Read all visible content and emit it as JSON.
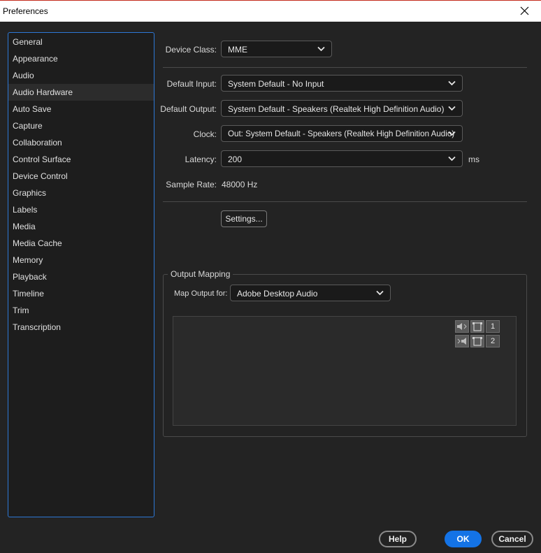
{
  "window": {
    "title": "Preferences"
  },
  "sidebar": {
    "items": [
      {
        "label": "General"
      },
      {
        "label": "Appearance"
      },
      {
        "label": "Audio"
      },
      {
        "label": "Audio Hardware"
      },
      {
        "label": "Auto Save"
      },
      {
        "label": "Capture"
      },
      {
        "label": "Collaboration"
      },
      {
        "label": "Control Surface"
      },
      {
        "label": "Device Control"
      },
      {
        "label": "Graphics"
      },
      {
        "label": "Labels"
      },
      {
        "label": "Media"
      },
      {
        "label": "Media Cache"
      },
      {
        "label": "Memory"
      },
      {
        "label": "Playback"
      },
      {
        "label": "Timeline"
      },
      {
        "label": "Trim"
      },
      {
        "label": "Transcription"
      }
    ],
    "selected": "Audio Hardware"
  },
  "audio_hardware": {
    "device_class_label": "Device Class:",
    "device_class_value": "MME",
    "default_input_label": "Default Input:",
    "default_input_value": "System Default - No Input",
    "default_output_label": "Default Output:",
    "default_output_value": "System Default - Speakers (Realtek High Definition Audio)",
    "clock_label": "Clock:",
    "clock_value": "Out: System Default - Speakers (Realtek High Definition Audio)",
    "latency_label": "Latency:",
    "latency_value": "200",
    "latency_unit": "ms",
    "sample_rate_label": "Sample Rate:",
    "sample_rate_value": "48000 Hz",
    "settings_button": "Settings..."
  },
  "output_mapping": {
    "legend": "Output Mapping",
    "map_output_for_label": "Map Output for:",
    "map_output_for_value": "Adobe Desktop Audio",
    "channels": [
      "1",
      "2"
    ]
  },
  "footer": {
    "help_button": "Help",
    "ok_button": "OK",
    "cancel_button": "Cancel"
  },
  "colors": {
    "accent": "#1473e6",
    "sidebar_border": "#2d78d6",
    "background": "#232323"
  }
}
